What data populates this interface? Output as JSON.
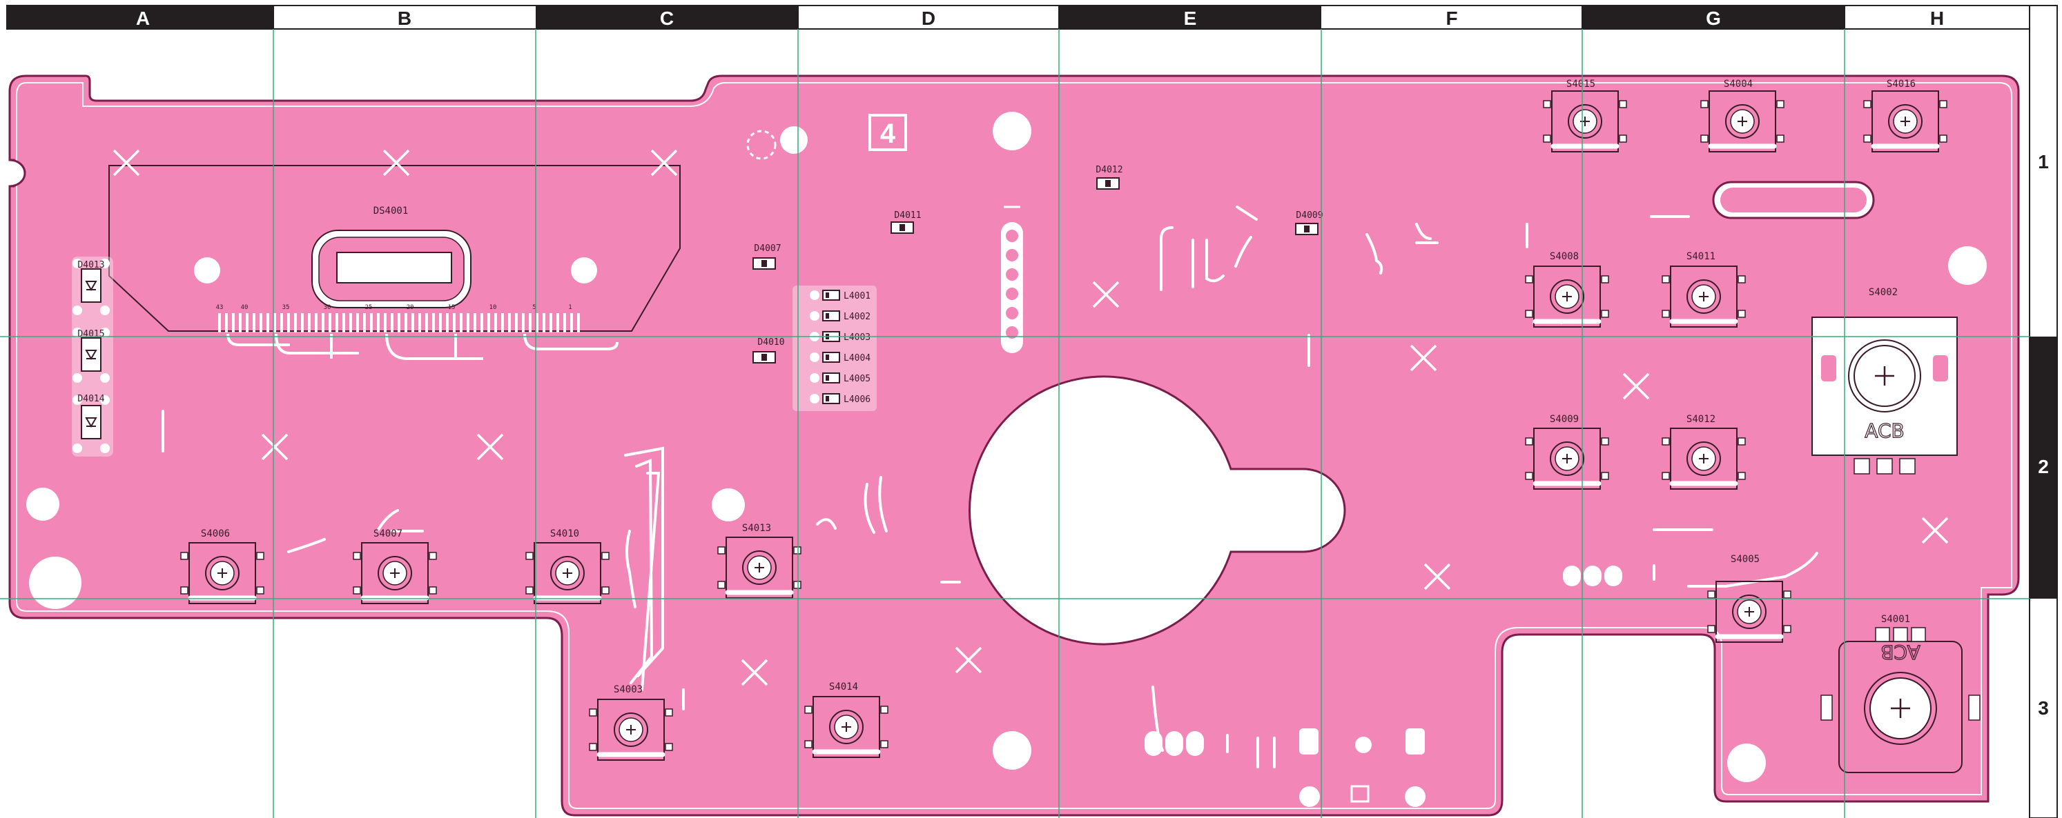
{
  "grid": {
    "columns": [
      "A",
      "B",
      "C",
      "D",
      "E",
      "F",
      "G",
      "H"
    ],
    "rows": [
      "1",
      "2",
      "3"
    ]
  },
  "board": {
    "page_marker": "4",
    "display": {
      "ref": "DS4001",
      "pin_labels": [
        "43",
        "40",
        "35",
        "30",
        "25",
        "20",
        "15",
        "10",
        "5",
        "1"
      ]
    },
    "switches": [
      "S4015",
      "S4004",
      "S4016",
      "S4008",
      "S4011",
      "S4009",
      "S4012",
      "S4006",
      "S4007",
      "S4010",
      "S4013",
      "S4005",
      "S4003",
      "S4014"
    ],
    "diodes": [
      "D4013",
      "D4015",
      "D4014",
      "D4007",
      "D4010",
      "D4011",
      "D4012",
      "D4009"
    ],
    "leds": [
      "L4001",
      "L4002",
      "L4003",
      "L4004",
      "L4005",
      "L4006"
    ],
    "encoders": [
      {
        "ref": "S4002",
        "pins": "ACB"
      },
      {
        "ref": "S4001",
        "pins": "ACB"
      }
    ]
  },
  "colors": {
    "board_fill": "#f287b7",
    "trace": "#ffffff",
    "outline": "#7a1d4a",
    "grid_line": "#2eaf7d",
    "header_dark": "#231f20"
  }
}
